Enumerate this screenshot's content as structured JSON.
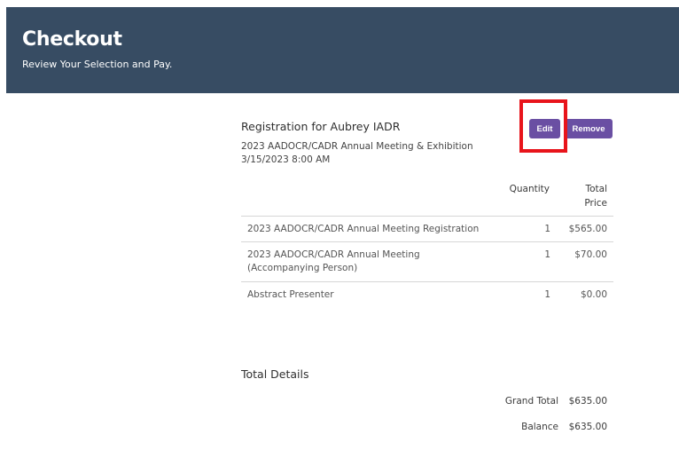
{
  "header": {
    "title": "Checkout",
    "subtitle": "Review Your Selection and Pay."
  },
  "registration": {
    "title": "Registration for Aubrey IADR",
    "event_name": "2023 AADOCR/CADR Annual Meeting & Exhibition",
    "event_date": "3/15/2023 8:00 AM",
    "edit_label": "Edit",
    "remove_label": "Remove"
  },
  "table": {
    "quantity_header": "Quantity",
    "total_price_header_line1": "Total",
    "total_price_header_line2": "Price",
    "rows": [
      {
        "name": "2023 AADOCR/CADR Annual Meeting Registration",
        "quantity": "1",
        "price": "$565.00"
      },
      {
        "name": "2023 AADOCR/CADR Annual Meeting (Accompanying Person)",
        "quantity": "1",
        "price": "$70.00"
      },
      {
        "name": "Abstract Presenter",
        "quantity": "1",
        "price": "$0.00"
      }
    ]
  },
  "totals": {
    "title": "Total Details",
    "grand_total_label": "Grand Total",
    "grand_total_value": "$635.00",
    "balance_label": "Balance",
    "balance_value": "$635.00"
  },
  "colors": {
    "header_bg": "#374c63",
    "button_bg": "#6a4fa3",
    "highlight": "#e8141b"
  }
}
